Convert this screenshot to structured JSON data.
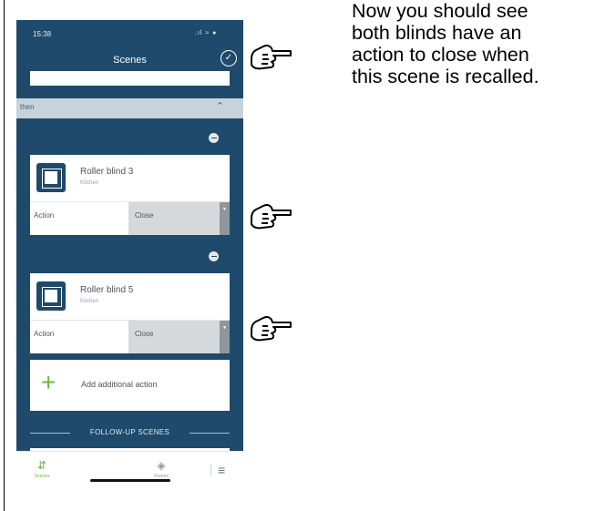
{
  "status_bar": {
    "time": "15:38",
    "icons": ".ıl ≈ ●"
  },
  "header": {
    "title": "Scenes",
    "confirm_icon": "check-circle-icon"
  },
  "section": {
    "label": "then",
    "chevron": "⌃"
  },
  "actions": [
    {
      "device": "Roller blind 3",
      "room": "Kitchen",
      "action_label": "Action",
      "action_value": "Close"
    },
    {
      "device": "Roller blind 5",
      "room": "Kitchen",
      "action_label": "Action",
      "action_value": "Close"
    }
  ],
  "add_action": {
    "label": "Add additional action",
    "icon": "+"
  },
  "followup": {
    "label": "FOLLOW-UP SCENES"
  },
  "tabbar": {
    "scenes_label": "Scenes",
    "rooms_label": "Rooms",
    "scenes_icon": "⇵",
    "rooms_icon": "◈",
    "menu_icon": "≡"
  },
  "caption": "Now you should see\nboth blinds have an\naction to close when\nthis scene is recalled.",
  "colors": {
    "app_blue": "#1f4a6b",
    "accent_green": "#69b744",
    "section_bar": "#c7d2dc"
  }
}
